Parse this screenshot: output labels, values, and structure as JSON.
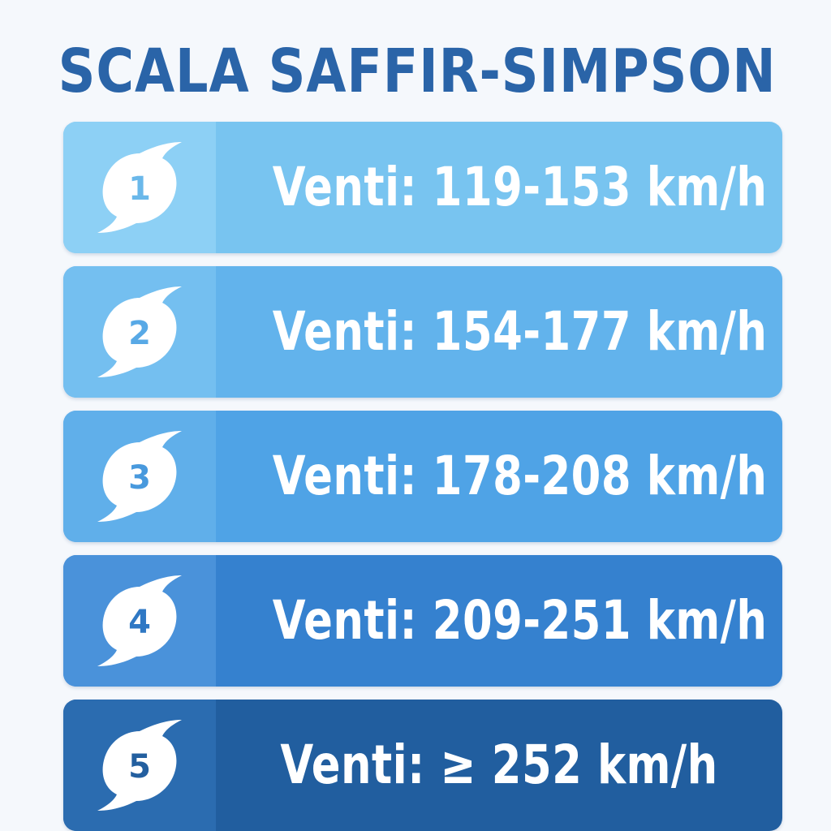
{
  "title": "SCALA SAFFIR-SIMPSON",
  "categories": [
    {
      "number": "1",
      "label": "Venti: 119-153 km/h",
      "color_main": "#78c4f0",
      "color_badge": "#8dd0f5",
      "number_color": "#6ab8ea"
    },
    {
      "number": "2",
      "label": "Venti: 154-177 km/h",
      "color_main": "#62b3ec",
      "color_badge": "#74bff0",
      "number_color": "#58a9e6"
    },
    {
      "number": "3",
      "label": "Venti: 178-208 km/h",
      "color_main": "#4fa3e6",
      "color_badge": "#60afea",
      "number_color": "#4899dd"
    },
    {
      "number": "4",
      "label": "Venti: 209-251 km/h",
      "color_main": "#3581cf",
      "color_badge": "#4a92da",
      "number_color": "#2f78c4"
    },
    {
      "number": "5",
      "label": "Venti: ≥ 252 km/h",
      "color_main": "#215e9f",
      "color_badge": "#2b6cb0",
      "number_color": "#235f9f"
    }
  ],
  "icon": "hurricane-icon"
}
